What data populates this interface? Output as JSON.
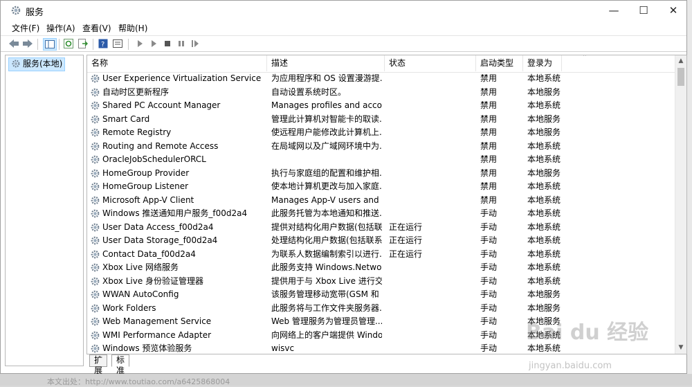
{
  "window": {
    "title": "服务"
  },
  "menu": [
    "文件(F)",
    "操作(A)",
    "查看(V)",
    "帮助(H)"
  ],
  "tree": {
    "root": "服务(本地)"
  },
  "columns": {
    "name": "名称",
    "desc": "描述",
    "status": "状态",
    "startup": "启动类型",
    "logon": "登录为"
  },
  "services": [
    {
      "name": "User Experience Virtualization Service",
      "desc": "为应用程序和 OS 设置漫游提...",
      "status": "",
      "startup": "禁用",
      "logon": "本地系统"
    },
    {
      "name": "自动时区更新程序",
      "desc": "自动设置系统时区。",
      "status": "",
      "startup": "禁用",
      "logon": "本地服务"
    },
    {
      "name": "Shared PC Account Manager",
      "desc": "Manages profiles and acco...",
      "status": "",
      "startup": "禁用",
      "logon": "本地系统"
    },
    {
      "name": "Smart Card",
      "desc": "管理此计算机对智能卡的取读...",
      "status": "",
      "startup": "禁用",
      "logon": "本地服务"
    },
    {
      "name": "Remote Registry",
      "desc": "使远程用户能修改此计算机上...",
      "status": "",
      "startup": "禁用",
      "logon": "本地服务"
    },
    {
      "name": "Routing and Remote Access",
      "desc": "在局域网以及广域网环境中为...",
      "status": "",
      "startup": "禁用",
      "logon": "本地系统"
    },
    {
      "name": "OracleJobSchedulerORCL",
      "desc": "",
      "status": "",
      "startup": "禁用",
      "logon": "本地系统"
    },
    {
      "name": "HomeGroup Provider",
      "desc": "执行与家庭组的配置和维护相...",
      "status": "",
      "startup": "禁用",
      "logon": "本地服务"
    },
    {
      "name": "HomeGroup Listener",
      "desc": "使本地计算机更改与加入家庭...",
      "status": "",
      "startup": "禁用",
      "logon": "本地系统"
    },
    {
      "name": "Microsoft App-V Client",
      "desc": "Manages App-V users and ...",
      "status": "",
      "startup": "禁用",
      "logon": "本地系统"
    },
    {
      "name": "Windows 推送通知用户服务_f00d2a4",
      "desc": "此服务托管为本地通知和推送...",
      "status": "",
      "startup": "手动",
      "logon": "本地系统"
    },
    {
      "name": "User Data Access_f00d2a4",
      "desc": "提供对结构化用户数据(包括联...",
      "status": "正在运行",
      "startup": "手动",
      "logon": "本地系统"
    },
    {
      "name": "User Data Storage_f00d2a4",
      "desc": "处理结构化用户数据(包括联系...",
      "status": "正在运行",
      "startup": "手动",
      "logon": "本地系统"
    },
    {
      "name": "Contact Data_f00d2a4",
      "desc": "为联系人数据编制索引以进行...",
      "status": "正在运行",
      "startup": "手动",
      "logon": "本地系统"
    },
    {
      "name": "Xbox Live 网络服务",
      "desc": "此服务支持 Windows.Netwo...",
      "status": "",
      "startup": "手动",
      "logon": "本地系统"
    },
    {
      "name": "Xbox Live 身份验证管理器",
      "desc": "提供用于与 Xbox Live 进行交...",
      "status": "",
      "startup": "手动",
      "logon": "本地系统"
    },
    {
      "name": "WWAN AutoConfig",
      "desc": "该服务管理移动宽带(GSM 和 ...",
      "status": "",
      "startup": "手动",
      "logon": "本地服务"
    },
    {
      "name": "Work Folders",
      "desc": "此服务将与工作文件夹服务器...",
      "status": "",
      "startup": "手动",
      "logon": "本地服务"
    },
    {
      "name": "Web Management Service",
      "desc": "Web 管理服务为管理员管理...",
      "status": "",
      "startup": "手动",
      "logon": "本地服务"
    },
    {
      "name": "WMI Performance Adapter",
      "desc": "向网络上的客户端提供 Windo...",
      "status": "",
      "startup": "手动",
      "logon": "本地系统"
    },
    {
      "name": "Windows 预览体验服务",
      "desc": "wisvc",
      "status": "",
      "startup": "手动",
      "logon": "本地系统"
    }
  ],
  "tabs": [
    "扩展",
    "标准"
  ],
  "watermark": {
    "main": "Bai du 经验",
    "sub": "jingyan.baidu.com"
  },
  "footer_text": "本文出处：http://www.toutiao.com/a6425868004"
}
